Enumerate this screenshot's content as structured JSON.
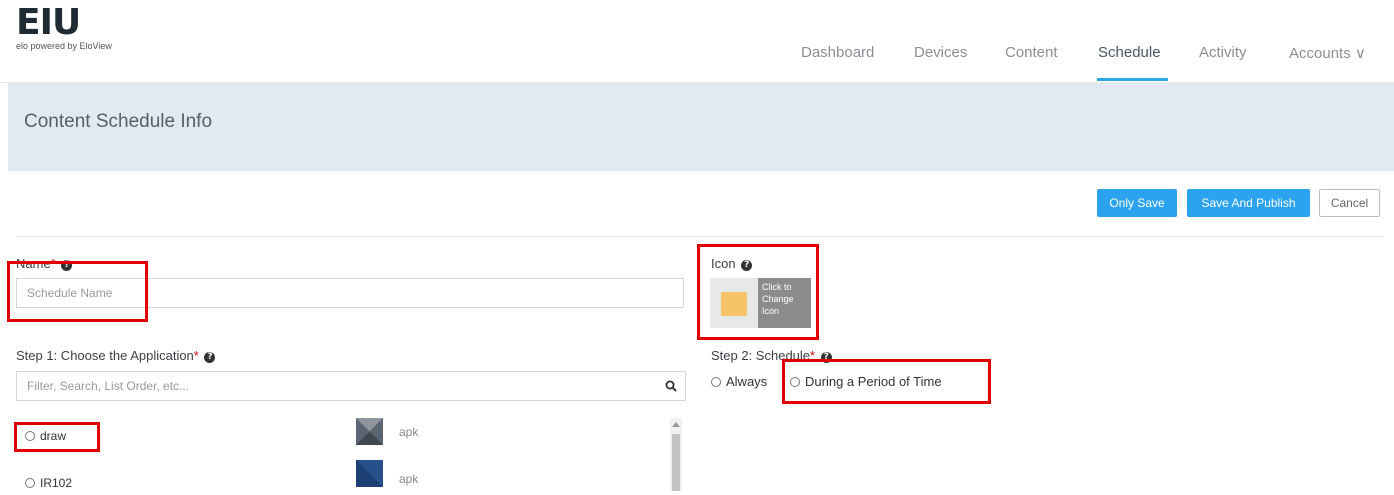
{
  "brand": {
    "logo": "EIU",
    "tagline": "elo powered by EloView"
  },
  "nav": {
    "items": [
      {
        "label": "Dashboard"
      },
      {
        "label": "Devices"
      },
      {
        "label": "Content"
      },
      {
        "label": "Schedule",
        "active": true
      },
      {
        "label": "Activity"
      },
      {
        "label": "Accounts ∨"
      }
    ]
  },
  "page": {
    "title": "Content Schedule Info"
  },
  "actions": {
    "only_save": "Only Save",
    "save_publish": "Save And Publish",
    "cancel": "Cancel"
  },
  "form": {
    "name": {
      "label": "Name",
      "required_mark": "*",
      "help": "?",
      "placeholder": "Schedule Name",
      "value": ""
    },
    "icon": {
      "label": "Icon",
      "help": "?",
      "change_text": "Click to Change Icon",
      "swatch_color": "#f5c468"
    },
    "step1": {
      "label": "Step 1: Choose the Application",
      "required_mark": "*",
      "help": "?",
      "filter_placeholder": "Filter, Search, List Order, etc...",
      "search_icon": "search-icon"
    },
    "step2": {
      "label": "Step 2: Schedule",
      "required_mark": "*",
      "help": "?",
      "options": [
        {
          "label": "Always"
        },
        {
          "label": "During a Period of Time"
        }
      ]
    }
  },
  "apps": [
    {
      "name": "draw",
      "type": "apk",
      "thumb_color": "#5b6470"
    },
    {
      "name": "IR102",
      "type": "apk",
      "thumb_color": "#1d3f73"
    }
  ],
  "colors": {
    "accent": "#2aa8e6",
    "button": "#2ca3ee",
    "banner": "#e1eaf3",
    "highlight": "#e00000",
    "required": "#d0021b"
  }
}
